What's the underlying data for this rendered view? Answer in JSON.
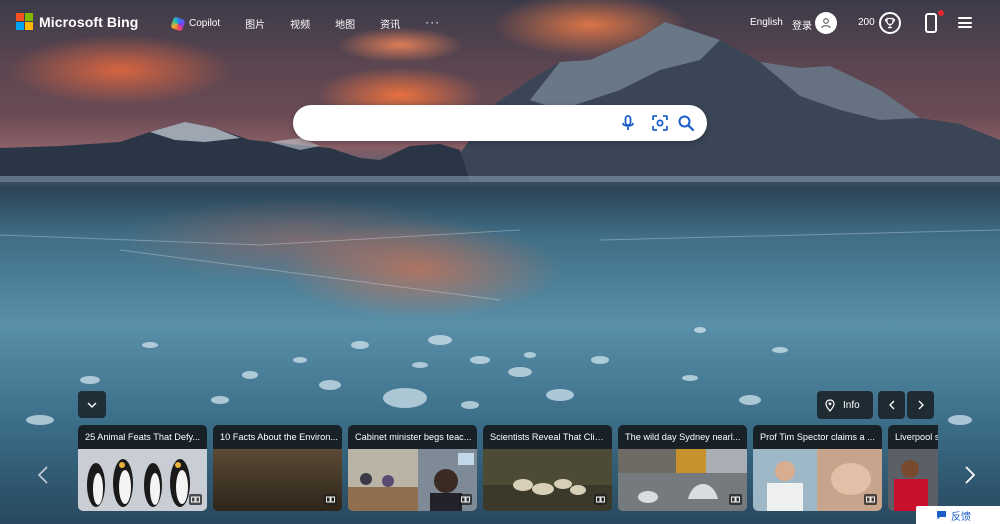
{
  "brand": {
    "logo_text": "Microsoft Bing",
    "square_colors": [
      "#f25022",
      "#7fba00",
      "#00a4ef",
      "#ffb900"
    ]
  },
  "nav": {
    "items": [
      {
        "label": "Copilot",
        "icon": "copilot-icon"
      },
      {
        "label": "图片"
      },
      {
        "label": "视频"
      },
      {
        "label": "地图"
      },
      {
        "label": "资讯"
      }
    ],
    "more": "···"
  },
  "header_right": {
    "language": "English",
    "login": "登录",
    "rewards_points": "200",
    "icons": [
      "user-icon",
      "trophy-icon",
      "phone-icon",
      "hamburger-menu-icon"
    ]
  },
  "search": {
    "value": "",
    "placeholder": "",
    "icons": [
      "microphone-icon",
      "visual-search-icon",
      "search-icon"
    ],
    "accent": "#1c5ec8"
  },
  "image_controls": {
    "info_label": "Info",
    "icons": [
      "chevron-down-icon",
      "location-pin-icon",
      "chevron-left-icon",
      "chevron-right-icon"
    ]
  },
  "news_cards": [
    {
      "title": "25 Animal Feats That Defy..."
    },
    {
      "title": "10 Facts About the Environ..."
    },
    {
      "title": "Cabinet minister begs teac..."
    },
    {
      "title": "Scientists Reveal That Clim..."
    },
    {
      "title": "The wild day Sydney nearl..."
    },
    {
      "title": "Prof Tim Spector claims a ..."
    },
    {
      "title": "Liverpool s"
    }
  ],
  "feedback": {
    "label": "反馈"
  }
}
